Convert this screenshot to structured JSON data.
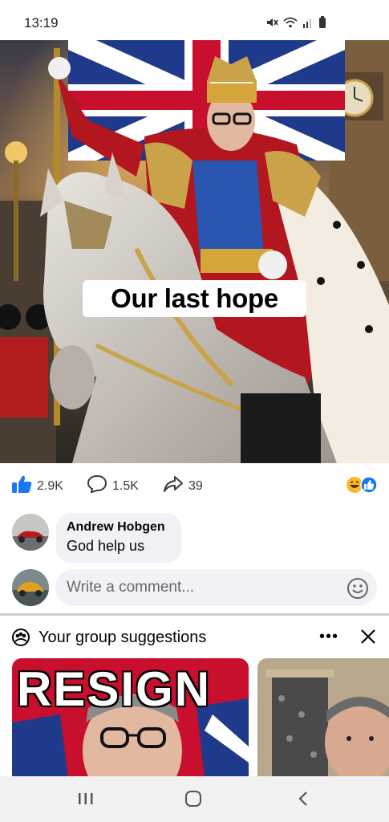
{
  "status_bar": {
    "time": "13:19",
    "icons": [
      "mute-icon",
      "wifi-icon",
      "signal-icon",
      "battery-icon"
    ]
  },
  "post": {
    "image_caption": "Our last hope",
    "reactions": {
      "like_count": "2.9K",
      "comment_count": "1.5K",
      "share_count": "39",
      "emoji_types": [
        "laugh-emoji",
        "like-emoji"
      ]
    }
  },
  "comment": {
    "author": "Andrew Hobgen",
    "text": "God help us"
  },
  "comment_input": {
    "placeholder": "Write a comment..."
  },
  "group_suggestions": {
    "title": "Your group suggestions",
    "more_label": "•••",
    "cards": [
      {
        "image_text": "RESIGN"
      },
      {
        "image_text": ""
      }
    ]
  },
  "colors": {
    "facebook_blue": "#1877f2",
    "bubble_bg": "#f0f2f5",
    "secondary_text": "#65676b"
  }
}
